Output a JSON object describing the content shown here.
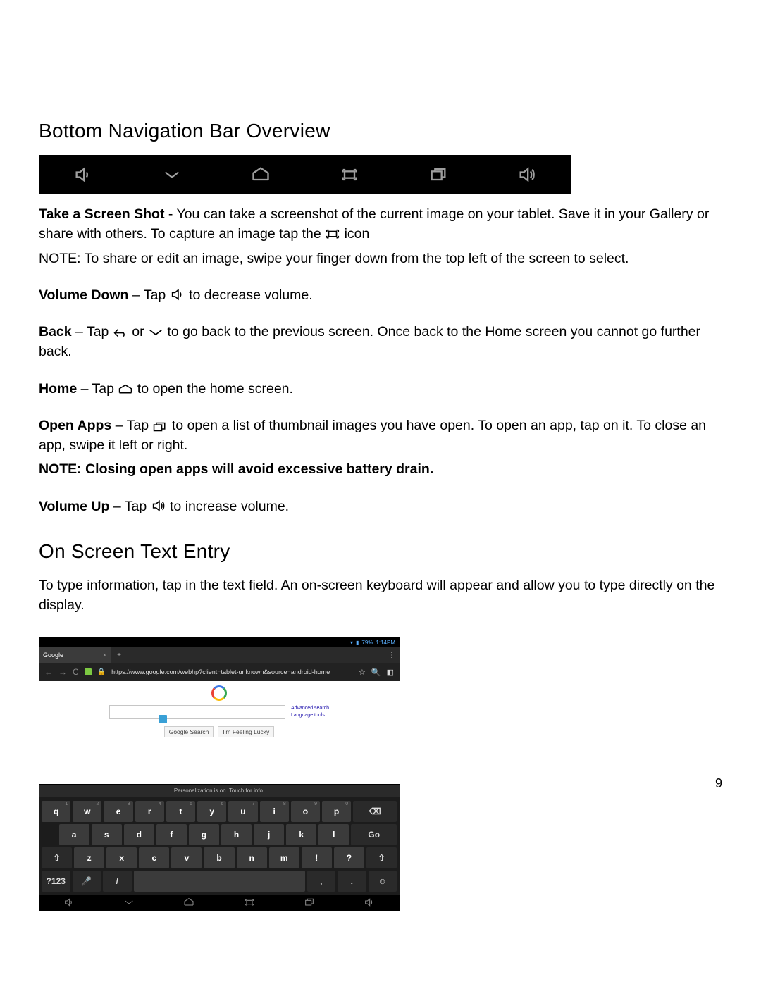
{
  "heading1": "Bottom Navigation Bar Overview",
  "screenshot_label": "Take a Screen Shot",
  "screenshot_text_a": " - You can take a screenshot of the current image on your tablet. Save it in your Gallery or share with others. To capture an image tap the ",
  "screenshot_text_b": " icon",
  "screenshot_note": "NOTE: To share or edit an image, swipe your finger down from the top left of the screen to select.",
  "voldown_label": "Volume Down",
  "voldown_text_a": " – Tap ",
  "voldown_text_b": " to decrease volume.",
  "back_label": "Back",
  "back_text_a": " – Tap ",
  "back_text_or": " or ",
  "back_text_b": " to go back to the previous screen. Once back to the Home screen you cannot go further back.",
  "home_label": "Home",
  "home_text_a": " – Tap ",
  "home_text_b": " to open the home screen.",
  "openapps_label": "Open Apps",
  "openapps_text_a": " – Tap ",
  "openapps_text_b": " to open a list of thumbnail images you have open. To open an app, tap on it. To close an app, swipe it left or right.",
  "openapps_note": "NOTE: Closing open apps will avoid excessive battery drain.",
  "volup_label": "Volume Up",
  "volup_text_a": " – Tap ",
  "volup_text_b": " to increase volume.",
  "heading2": "On Screen Text Entry",
  "text_entry_para": "To type information, tap in the text field. An on-screen keyboard will appear and allow you to type directly on the display.",
  "page_number": "9",
  "tablet": {
    "status_battery": "79%",
    "status_time": "1:14PM",
    "tab_title": "Google",
    "url": "https://www.google.com/webhp?client=tablet-unknown&source=android-home",
    "side_link1": "Advanced search",
    "side_link2": "Language tools",
    "btn_search": "Google Search",
    "btn_lucky": "I'm Feeling Lucky",
    "kb_hint": "Personalization is on. Touch for info.",
    "row1": [
      "q",
      "w",
      "e",
      "r",
      "t",
      "y",
      "u",
      "i",
      "o",
      "p"
    ],
    "row1_sup": [
      "1",
      "2",
      "3",
      "4",
      "5",
      "6",
      "7",
      "8",
      "9",
      "0"
    ],
    "row2": [
      "a",
      "s",
      "d",
      "f",
      "g",
      "h",
      "j",
      "k",
      "l"
    ],
    "row3": [
      "z",
      "x",
      "c",
      "v",
      "b",
      "n",
      "m",
      "!",
      "?"
    ],
    "key_go": "Go",
    "key_sym": "?123",
    "key_comma": ",",
    "key_period": "."
  }
}
